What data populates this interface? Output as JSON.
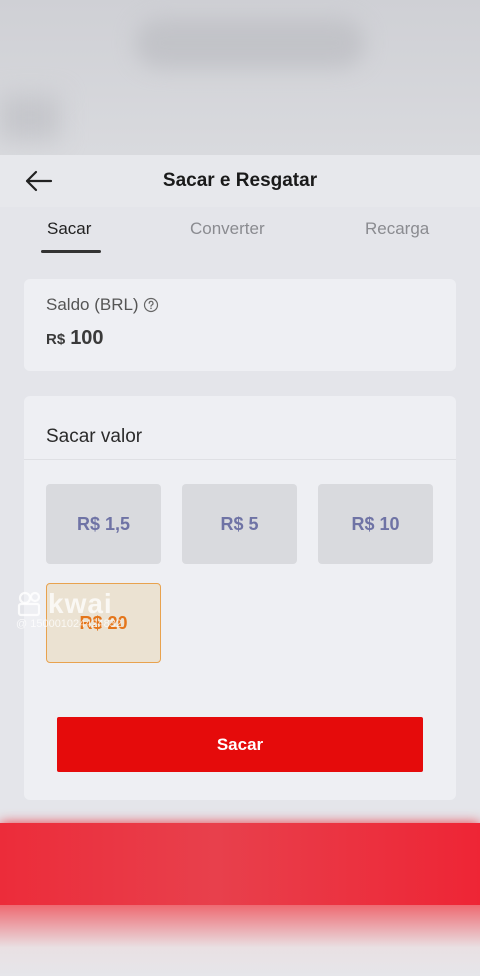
{
  "header": {
    "title": "Sacar e Resgatar"
  },
  "tabs": [
    {
      "label": "Sacar",
      "active": true
    },
    {
      "label": "Converter",
      "active": false
    },
    {
      "label": "Recarga",
      "active": false
    }
  ],
  "balance": {
    "label": "Saldo (BRL)",
    "currency": "R$",
    "amount": "100"
  },
  "withdraw": {
    "title": "Sacar valor",
    "options": [
      "R$ 1,5",
      "R$ 5",
      "R$ 10",
      "R$ 20"
    ],
    "selected_index": 3,
    "submit_label": "Sacar"
  },
  "watermark": {
    "brand": "kwai",
    "id": "@ 150001024424832"
  },
  "colors": {
    "primary_red": "#e50b0b",
    "selected_orange": "#e4751a",
    "option_text": "#6f73a5"
  }
}
